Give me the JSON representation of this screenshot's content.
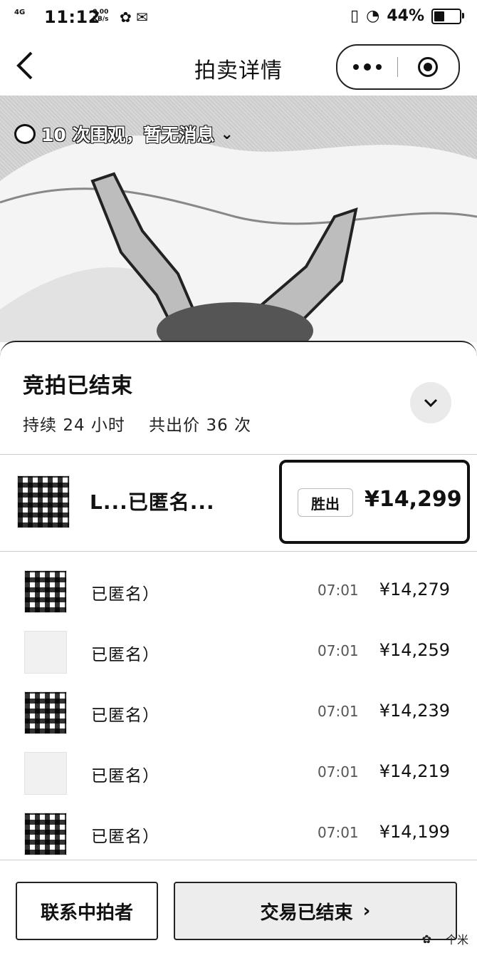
{
  "status_bar": {
    "network": "4G",
    "time": "11:12",
    "speed_value": "0.00",
    "speed_unit": "KB/s",
    "battery_text": "44%",
    "battery_level": 0.44
  },
  "nav": {
    "title": "拍卖详情"
  },
  "hero": {
    "views_text": "10 次围观，暂无消息"
  },
  "auction": {
    "status": "竞拍已结束",
    "duration_label": "持续",
    "duration_value": "24",
    "duration_unit": "小时",
    "bids_label": "共出价",
    "bids_value": "36",
    "bids_unit": "次"
  },
  "top_bid": {
    "name": "L...已匿名...",
    "tag": "胜出",
    "price": "¥14,299"
  },
  "bids": [
    {
      "name": "已匿名）",
      "time": "07:01",
      "price": "¥14,279"
    },
    {
      "name": "已匿名）",
      "time": "07:01",
      "price": "¥14,259"
    },
    {
      "name": "已匿名）",
      "time": "07:01",
      "price": "¥14,239"
    },
    {
      "name": "已匿名）",
      "time": "07:01",
      "price": "¥14,219"
    },
    {
      "name": "已匿名）",
      "time": "07:01",
      "price": "¥14,199"
    }
  ],
  "bottom": {
    "contact_label": "联系中拍者",
    "ended_label": "交易已结束",
    "ended_arrow": "›"
  },
  "watermark": "一个米"
}
